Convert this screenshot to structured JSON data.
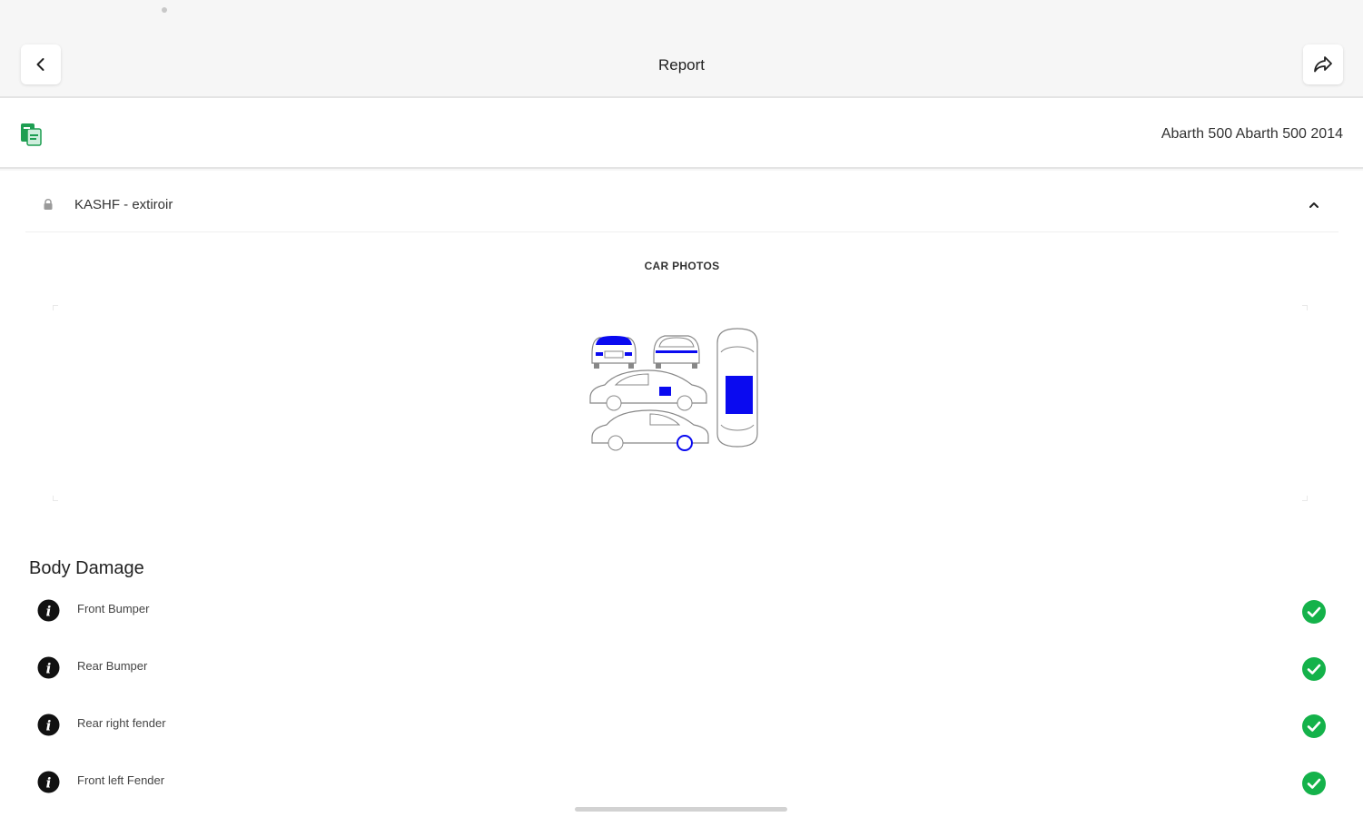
{
  "header": {
    "title": "Report"
  },
  "vehicle": {
    "name": "Abarth 500 Abarth 500 2014"
  },
  "section": {
    "title": "KASHF - extiroir"
  },
  "photos": {
    "title": "CAR PHOTOS"
  },
  "body_damage": {
    "title": "Body Damage",
    "items": [
      {
        "label": "Front Bumper",
        "status": "ok"
      },
      {
        "label": "Rear Bumper",
        "status": "ok"
      },
      {
        "label": "Rear right fender",
        "status": "ok"
      },
      {
        "label": "Front left Fender",
        "status": "ok"
      }
    ]
  },
  "colors": {
    "accent_green": "#14b24a",
    "damage_blue": "#0a0af0",
    "doc_green": "#1e9e52"
  }
}
